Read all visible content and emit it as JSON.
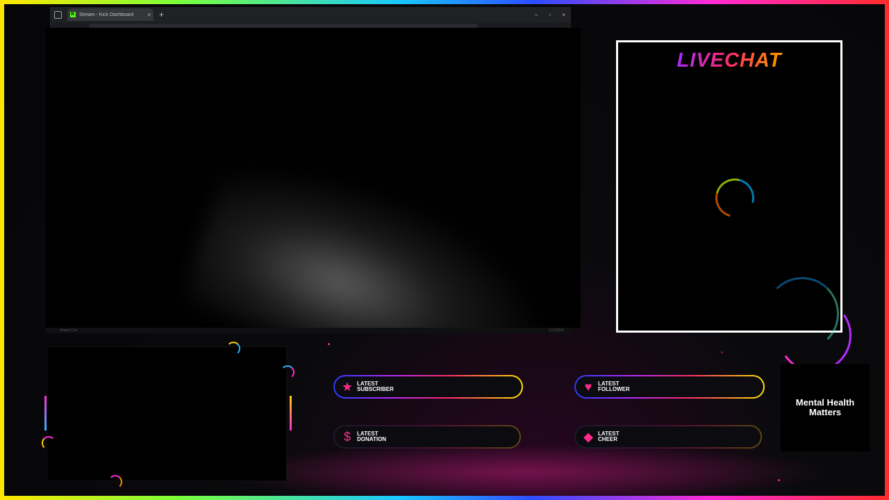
{
  "browser": {
    "tab_title": "Stream - Kick Dashboard",
    "tab_icon": "K",
    "new_tab": "+",
    "tab_close": "×",
    "controls": [
      "–",
      "▫",
      "×"
    ],
    "taskbar_label": "Wisely Corl",
    "taskbar_time": "1/11/2025"
  },
  "chat": {
    "title": "LIVECHAT"
  },
  "alerts": {
    "subscriber": {
      "line1": "LATEST",
      "line2": "SUBSCRIBER",
      "icon": "★"
    },
    "follower": {
      "line1": "LATEST",
      "line2": "FOLLOWER",
      "icon": "♥"
    },
    "donation": {
      "line1": "LATEST",
      "line2": "DONATION",
      "icon": "$"
    },
    "cheer": {
      "line1": "LATEST",
      "line2": "CHEER",
      "icon": "◆"
    }
  },
  "mental_health": {
    "text": "Mental Health Matters"
  },
  "colors": {
    "accent_pink": "#ff2b8a",
    "frame_gradient": [
      "#ffe600",
      "#7bff3a",
      "#18c8ff",
      "#2b4dff",
      "#ff2bd6",
      "#ff2b2b"
    ]
  }
}
